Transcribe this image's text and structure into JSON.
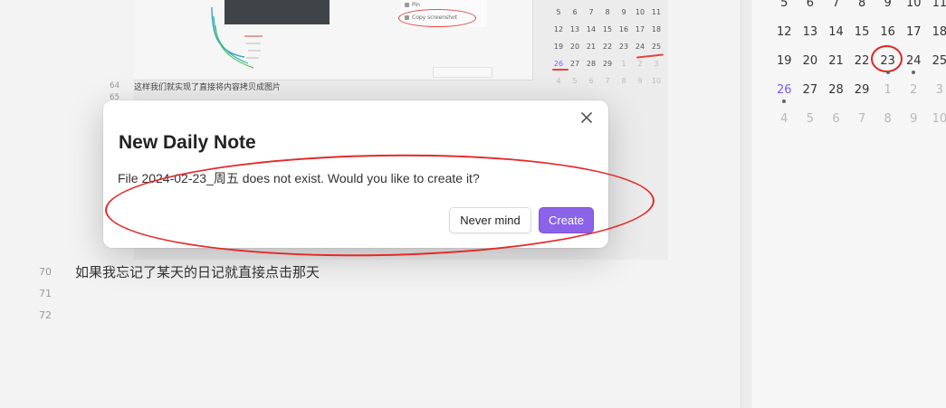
{
  "editor": {
    "embedded_screenshot": {
      "menu_item_1": "Pin",
      "menu_item_2": "Copy screenshot",
      "mini_calendar": {
        "rows": [
          [
            "5",
            "6",
            "7",
            "8",
            "9",
            "10",
            "11"
          ],
          [
            "12",
            "13",
            "14",
            "15",
            "16",
            "17",
            "18"
          ],
          [
            "19",
            "20",
            "21",
            "22",
            "23",
            "24",
            "25"
          ],
          [
            "26",
            "27",
            "28",
            "29",
            "1",
            "2",
            "3"
          ],
          [
            "4",
            "5",
            "6",
            "7",
            "8",
            "9",
            "10"
          ]
        ]
      }
    },
    "line_64": {
      "number": "64",
      "text": "这样我们就实现了直接将内容拷贝成图片"
    },
    "line_65": {
      "number": "65"
    },
    "lines": [
      {
        "number": "70",
        "text": "如果我忘记了某天的日记就直接点击那天"
      },
      {
        "number": "71",
        "text": ""
      },
      {
        "number": "72",
        "text": ""
      }
    ]
  },
  "calendar": {
    "rows": [
      [
        "5",
        "6",
        "7",
        "8",
        "9",
        "10",
        "11"
      ],
      [
        "12",
        "13",
        "14",
        "15",
        "16",
        "17",
        "18"
      ],
      [
        "19",
        "20",
        "21",
        "22",
        "23",
        "24",
        "25"
      ],
      [
        "26",
        "27",
        "28",
        "29",
        "1",
        "2",
        "3"
      ],
      [
        "4",
        "5",
        "6",
        "7",
        "8",
        "9",
        "10"
      ]
    ],
    "highlighted_today": "23",
    "accent_color": "#7a5af5"
  },
  "modal": {
    "title": "New Daily Note",
    "message": "File 2024-02-23_周五 does not exist. Would you like to create it?",
    "cancel_label": "Never mind",
    "create_label": "Create",
    "close_icon": "close-icon",
    "primary_color": "#8b63e8"
  },
  "annotation": {
    "color": "#e42a2a"
  }
}
